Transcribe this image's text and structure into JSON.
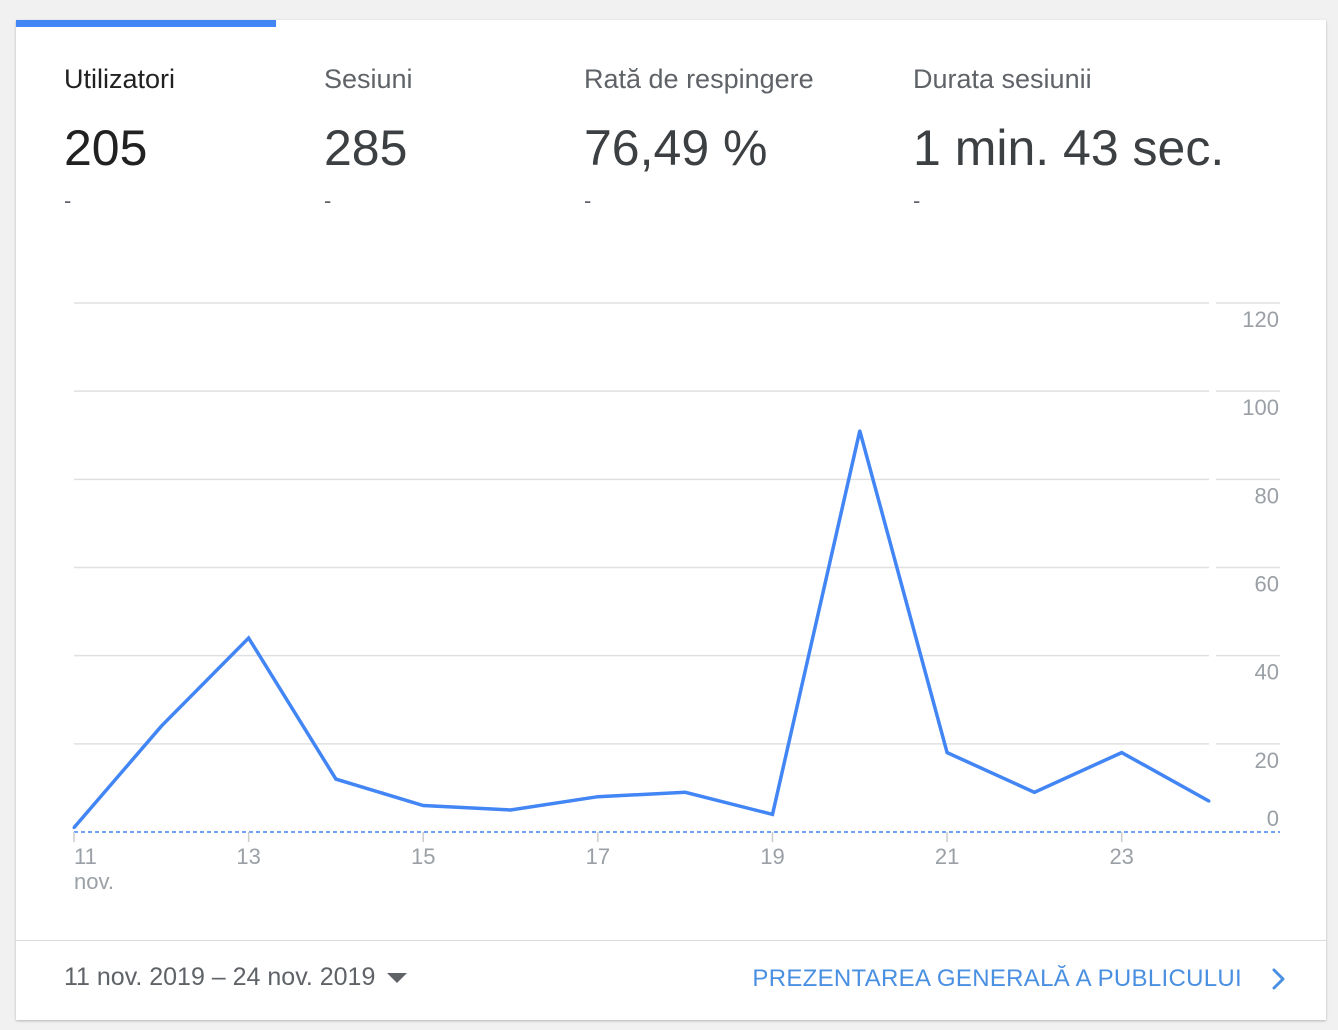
{
  "metrics": [
    {
      "label": "Utilizatori",
      "value": "205",
      "delta": "-"
    },
    {
      "label": "Sesiuni",
      "value": "285",
      "delta": "-"
    },
    {
      "label": "Rată de respingere",
      "value": "76,49 %",
      "delta": "-"
    },
    {
      "label": "Durata sesiunii",
      "value": "1 min. 43 sec.",
      "delta": "-"
    }
  ],
  "colors": {
    "accent": "#4285f4",
    "link": "#4a90e2"
  },
  "chart_data": {
    "type": "line",
    "title": "",
    "xlabel": "",
    "ylabel": "",
    "x": [
      "11",
      "12",
      "13",
      "14",
      "15",
      "16",
      "17",
      "18",
      "19",
      "20",
      "21",
      "22",
      "23",
      "24"
    ],
    "x_tick_labels": [
      "11",
      "13",
      "15",
      "17",
      "19",
      "21",
      "23"
    ],
    "x_tick_sublabel": "nov.",
    "y_ticks": [
      "0",
      "20",
      "40",
      "60",
      "80",
      "100",
      "120"
    ],
    "ylim": [
      0,
      120
    ],
    "grid": true,
    "series": [
      {
        "values": [
          1,
          24,
          44,
          12,
          6,
          5,
          8,
          9,
          4,
          91,
          18,
          9,
          18,
          7
        ],
        "color": "#4285f4"
      }
    ]
  },
  "footer": {
    "date_range": "11 nov. 2019 – 24 nov. 2019",
    "link": "PREZENTAREA GENERALĂ A PUBLICULUI"
  }
}
